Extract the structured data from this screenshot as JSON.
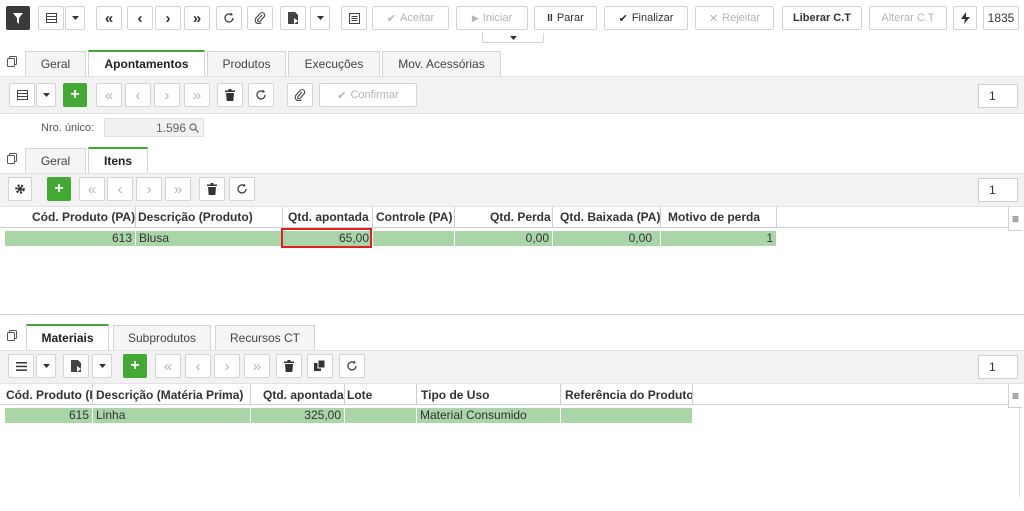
{
  "top_toolbar": {
    "aceitar": "Aceitar",
    "iniciar": "Iniciar",
    "parar": "Parar",
    "finalizar": "Finalizar",
    "rejeitar": "Rejeitar",
    "liberar": "Liberar C.T",
    "alterar": "Alterar C.T",
    "counter": "1835"
  },
  "main_tabs": [
    "Geral",
    "Apontamentos",
    "Produtos",
    "Execuções",
    "Mov. Acessórias"
  ],
  "apont_toolbar": {
    "confirmar": "Confirmar",
    "page": "1"
  },
  "nro_unico": {
    "label": "Nro. único:",
    "value": "1.596"
  },
  "sub_tabs": [
    "Geral",
    "Itens"
  ],
  "itens_toolbar": {
    "page": "1"
  },
  "itens_grid": {
    "headers": [
      "Cód. Produto (PA)",
      "Descrição (Produto)",
      "Qtd. apontada",
      "Controle (PA)",
      "Qtd. Perda",
      "Qtd. Baixada (PA)",
      "Motivo de perda"
    ],
    "rows": [
      [
        "613",
        "Blusa",
        "65,00",
        "",
        "0,00",
        "0,00",
        "1"
      ]
    ]
  },
  "bottom_tabs": [
    "Materiais",
    "Subprodutos",
    "Recursos CT"
  ],
  "materiais_toolbar": {
    "page": "1"
  },
  "materiais_grid": {
    "headers": [
      "Cód. Produto (I",
      "Descrição (Matéria Prima)",
      "Qtd. apontada",
      "Lote",
      "Tipo de Uso",
      "Referência do Produto"
    ],
    "rows": [
      [
        "615",
        "Linha",
        "325,00",
        "",
        "Material Consumido",
        ""
      ]
    ]
  },
  "colors": {
    "accent": "#43a834",
    "row": "#a9d5a9",
    "highlight": "#e02020"
  }
}
